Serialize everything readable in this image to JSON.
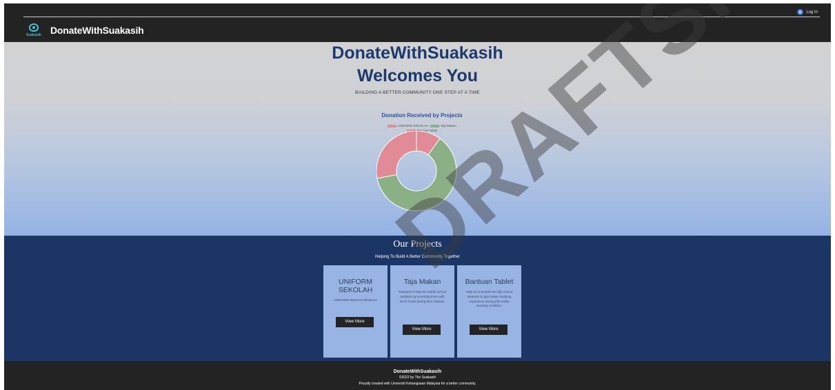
{
  "header": {
    "brand": "DonateWithSuakasih",
    "logo_text": "Suakasih",
    "login_label": "Log In",
    "login_icon": "user-icon"
  },
  "hero": {
    "title_line1": "DonateWithSuakasih",
    "title_line2": "Welcomes You",
    "tagline": "BUILDING A BETTER COMMUNITY ONE STEP AT A TIME"
  },
  "chart_data": {
    "type": "pie",
    "title": "Donation Received by Projects",
    "categories": [
      "UNIFORM SEKOLAH",
      "Taja Makan",
      "Bantuan Tablet"
    ],
    "values": [
      10,
      62,
      28
    ],
    "colors": [
      "#e08b95",
      "#8cb085",
      "#e08b95"
    ],
    "donut": true,
    "legend_position": "top"
  },
  "projects": {
    "title": "Our Projects",
    "subtitle": "Helping To Build A Better Community Together",
    "cards": [
      {
        "title": "UNIFORM SEKOLAH",
        "desc": "UNIFORM SEKOAH RENDAH",
        "button": "View More"
      },
      {
        "title": "Taja Makan",
        "desc": "Targeted to help 50 middle school students by providing them with lunch foods during their classes.",
        "button": "View More"
      },
      {
        "title": "Bantuan Tablet",
        "desc": "Help us to provide 50 high school students to gain better studying experience during this online learning condition.",
        "button": "View More"
      }
    ]
  },
  "footer": {
    "brand": "DonateWithSuakasih",
    "copyright": "©2022 by The Suakasih",
    "credit": "Proudly created with Universiti Kebangsaan Malaysia for a better community."
  },
  "watermark": "DRAFTSM"
}
